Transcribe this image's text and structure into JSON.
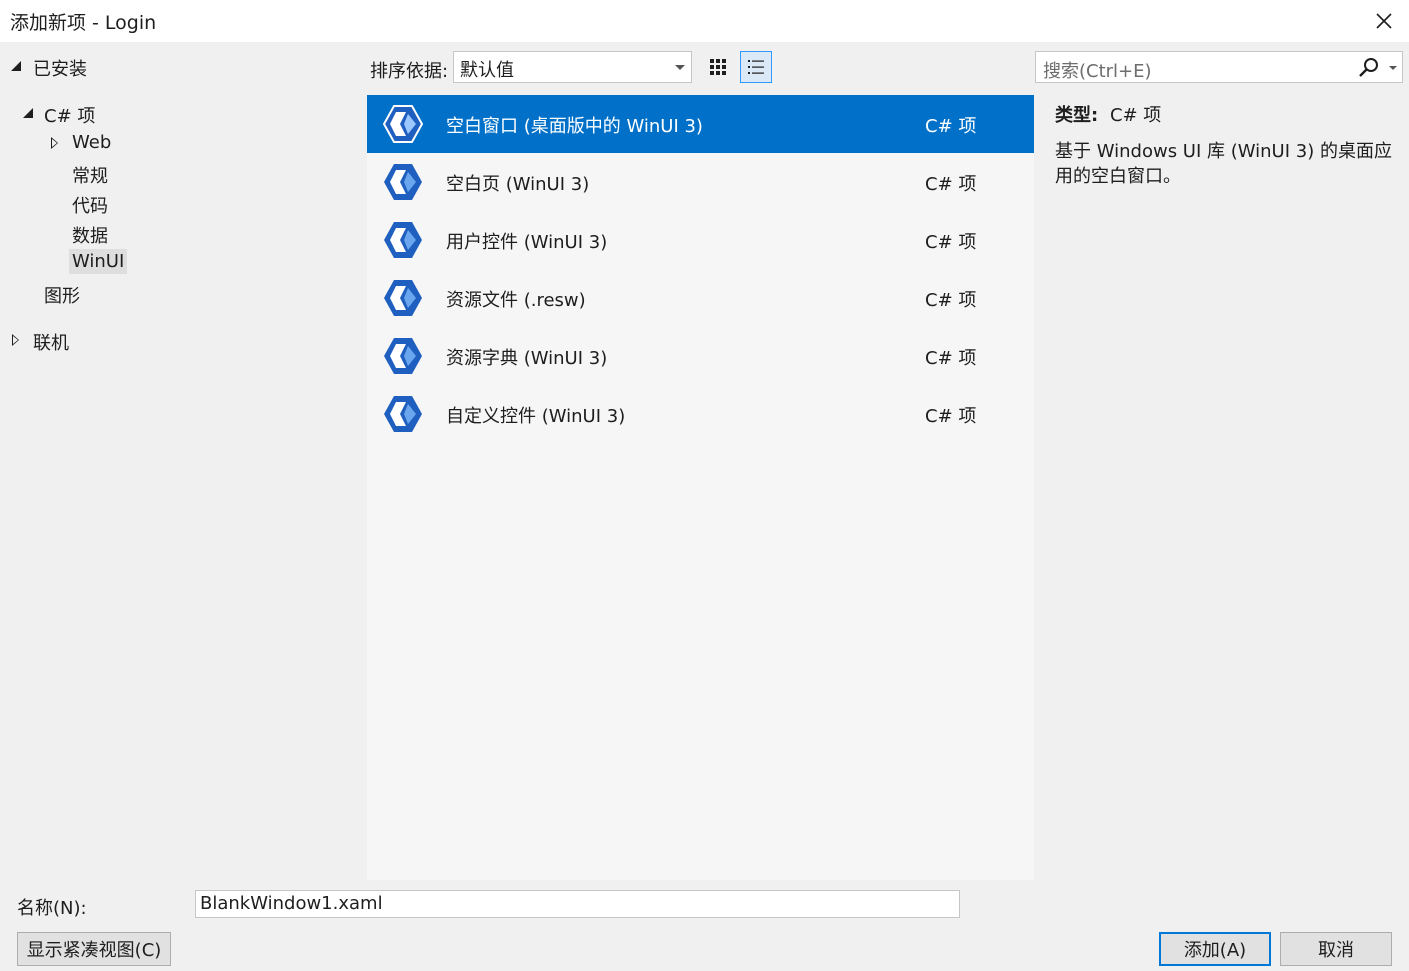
{
  "window": {
    "title": "添加新项 - Login"
  },
  "tree": {
    "installed": "已安装",
    "csharp": "C# 项",
    "children": [
      "Web",
      "常规",
      "代码",
      "数据",
      "WinUI"
    ],
    "graphics": "图形",
    "online": "联机",
    "selected": "WinUI"
  },
  "toolbar": {
    "sort_label": "排序依据:",
    "sort_value": "默认值"
  },
  "search": {
    "placeholder": "搜索(Ctrl+E)"
  },
  "templates": [
    {
      "name": "空白窗口 (桌面版中的 WinUI 3)",
      "type": "C# 项",
      "selected": true
    },
    {
      "name": "空白页 (WinUI 3)",
      "type": "C# 项"
    },
    {
      "name": "用户控件 (WinUI 3)",
      "type": "C# 项"
    },
    {
      "name": "资源文件 (.resw)",
      "type": "C# 项"
    },
    {
      "name": "资源字典 (WinUI 3)",
      "type": "C# 项"
    },
    {
      "name": "自定义控件 (WinUI 3)",
      "type": "C# 项"
    }
  ],
  "details": {
    "type_label": "类型:",
    "type_value": "C# 项",
    "description": "基于 Windows UI 库 (WinUI 3) 的桌面应用的空白窗口。"
  },
  "footer": {
    "name_label": "名称(N):",
    "name_value": "BlankWindow1.xaml",
    "compact_view": "显示紧凑视图(C)",
    "add": "添加(A)",
    "cancel": "取消"
  },
  "colors": {
    "selection": "#0070c9",
    "accent_border": "#0078d7"
  },
  "icons": [
    "close-icon",
    "grid-view-icon",
    "list-view-icon",
    "search-icon",
    "winui-template-icon"
  ]
}
